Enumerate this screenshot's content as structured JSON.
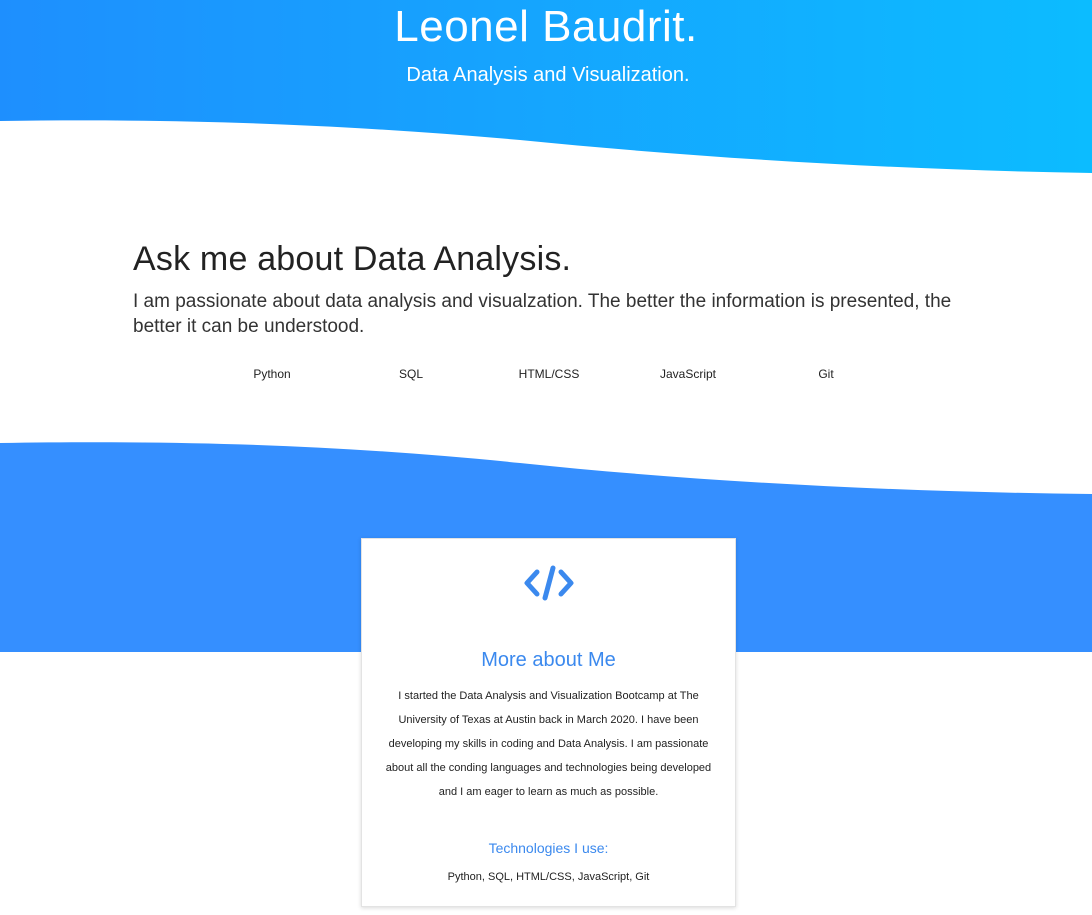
{
  "colors": {
    "hero_gradient_start": "#1e90ff",
    "hero_gradient_end": "#0bbcff",
    "band_blue": "#358fff",
    "accent_text": "#3b89ee"
  },
  "hero": {
    "title": "Leonel Baudrit.",
    "subtitle": "Data Analysis and Visualization."
  },
  "intro": {
    "heading": "Ask me about Data Analysis.",
    "text": "I am passionate about data analysis and visualzation. The better the information is presented, the better it can be understood."
  },
  "skills": [
    "Python",
    "SQL",
    "HTML/CSS",
    "JavaScript",
    "Git"
  ],
  "card": {
    "icon": "code-icon",
    "title": "More about Me",
    "text": "I started the Data Analysis and Visualization Bootcamp at The University of Texas at Austin back in March 2020. I have been developing my skills in coding and Data Analysis. I am passionate about all the conding languages and technologies being developed and I am eager to learn as much as possible.",
    "tech_heading": "Technologies I use:",
    "tech_list": "Python, SQL, HTML/CSS, JavaScript, Git"
  }
}
